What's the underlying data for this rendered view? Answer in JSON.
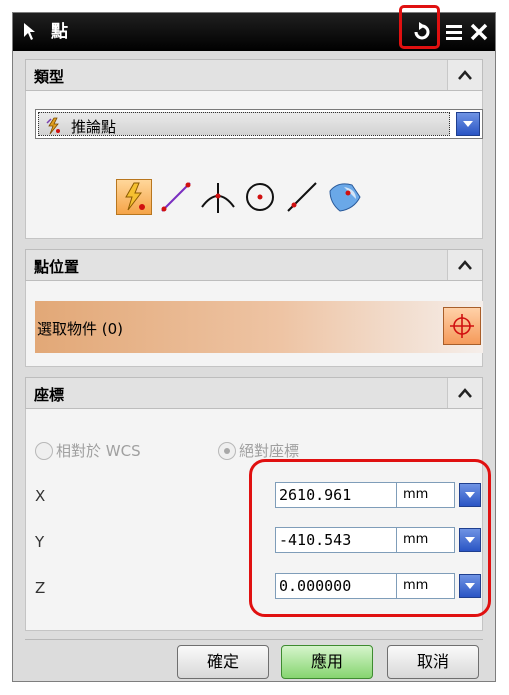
{
  "window": {
    "title": "點"
  },
  "sections": {
    "type": {
      "title": "類型",
      "selected": "推論點",
      "tools": [
        "inferred-point-icon",
        "point-on-curve-icon",
        "intersection-point-icon",
        "arc-center-icon",
        "end-point-icon",
        "surface-point-icon"
      ]
    },
    "point_location": {
      "title": "點位置",
      "select_label": "選取物件 (0)"
    },
    "coordinates": {
      "title": "座標",
      "radio_relative": "相對於 WCS",
      "radio_absolute": "絕對座標",
      "x_label": "X",
      "x_value": "2610.961",
      "x_unit": "mm",
      "y_label": "Y",
      "y_value": "-410.543",
      "y_unit": "mm",
      "z_label": "Z",
      "z_value": "0.000000",
      "z_unit": "mm"
    }
  },
  "footer": {
    "ok_label": "確定",
    "apply_label": "應用",
    "cancel_label": "取消"
  },
  "colors": {
    "titlebar": "#000000",
    "highlight": "#e01010",
    "dropdown_blue": "#2a55c4",
    "apply_green": "#86d570",
    "selection_orange": "#e2a877"
  }
}
